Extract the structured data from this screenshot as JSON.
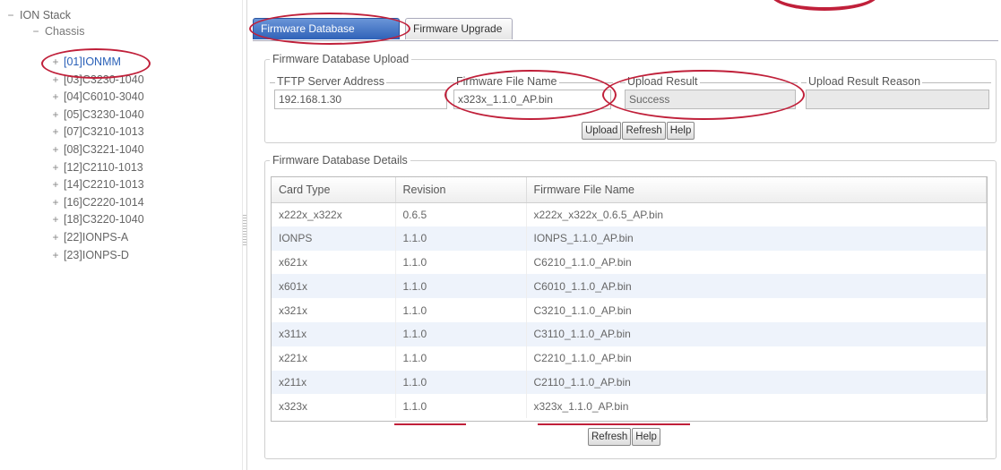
{
  "tree": {
    "root": {
      "toggle": "−",
      "label": "ION Stack"
    },
    "chassis": {
      "toggle": "−",
      "label": "Chassis"
    },
    "items": [
      {
        "toggle": "+",
        "label": "[01]IONMM",
        "selected": true
      },
      {
        "toggle": "+",
        "label": "[03]C3230-1040"
      },
      {
        "toggle": "+",
        "label": "[04]C6010-3040"
      },
      {
        "toggle": "+",
        "label": "[05]C3230-1040"
      },
      {
        "toggle": "+",
        "label": "[07]C3210-1013"
      },
      {
        "toggle": "+",
        "label": "[08]C3221-1040"
      },
      {
        "toggle": "+",
        "label": "[12]C2110-1013"
      },
      {
        "toggle": "+",
        "label": "[14]C2210-1013"
      },
      {
        "toggle": "+",
        "label": "[16]C2220-1014"
      },
      {
        "toggle": "+",
        "label": "[18]C3220-1040"
      },
      {
        "toggle": "+",
        "label": "[22]IONPS-A"
      },
      {
        "toggle": "+",
        "label": "[23]IONPS-D"
      }
    ]
  },
  "tabs": [
    {
      "label": "Firmware Database",
      "active": true
    },
    {
      "label": "Firmware Upgrade",
      "active": false
    }
  ],
  "upload": {
    "legend": "Firmware Database Upload",
    "tftp": {
      "label": "TFTP Server Address",
      "value": "192.168.1.30"
    },
    "file_name": {
      "label": "Firmware File Name",
      "value": "x323x_1.1.0_AP.bin"
    },
    "result": {
      "label": "Upload Result",
      "value": "Success"
    },
    "reason": {
      "label": "Upload Result Reason",
      "value": ""
    },
    "buttons": {
      "upload": "Upload",
      "refresh": "Refresh",
      "help": "Help"
    }
  },
  "details": {
    "legend": "Firmware Database Details",
    "columns": [
      "Card Type",
      "Revision",
      "Firmware File Name"
    ],
    "rows": [
      [
        "x222x_x322x",
        "0.6.5",
        "x222x_x322x_0.6.5_AP.bin"
      ],
      [
        "IONPS",
        "1.1.0",
        "IONPS_1.1.0_AP.bin"
      ],
      [
        "x621x",
        "1.1.0",
        "C6210_1.1.0_AP.bin"
      ],
      [
        "x601x",
        "1.1.0",
        "C6010_1.1.0_AP.bin"
      ],
      [
        "x321x",
        "1.1.0",
        "C3210_1.1.0_AP.bin"
      ],
      [
        "x311x",
        "1.1.0",
        "C3110_1.1.0_AP.bin"
      ],
      [
        "x221x",
        "1.1.0",
        "C2210_1.1.0_AP.bin"
      ],
      [
        "x211x",
        "1.1.0",
        "C2110_1.1.0_AP.bin"
      ],
      [
        "x323x",
        "1.1.0",
        "x323x_1.1.0_AP.bin"
      ]
    ],
    "buttons": {
      "refresh": "Refresh",
      "help": "Help"
    }
  },
  "colors": {
    "tab_active": "#2f62b8",
    "annotation": "#c0203a",
    "selected_node": "#2960b8",
    "row_alt": "#eef3fb"
  }
}
